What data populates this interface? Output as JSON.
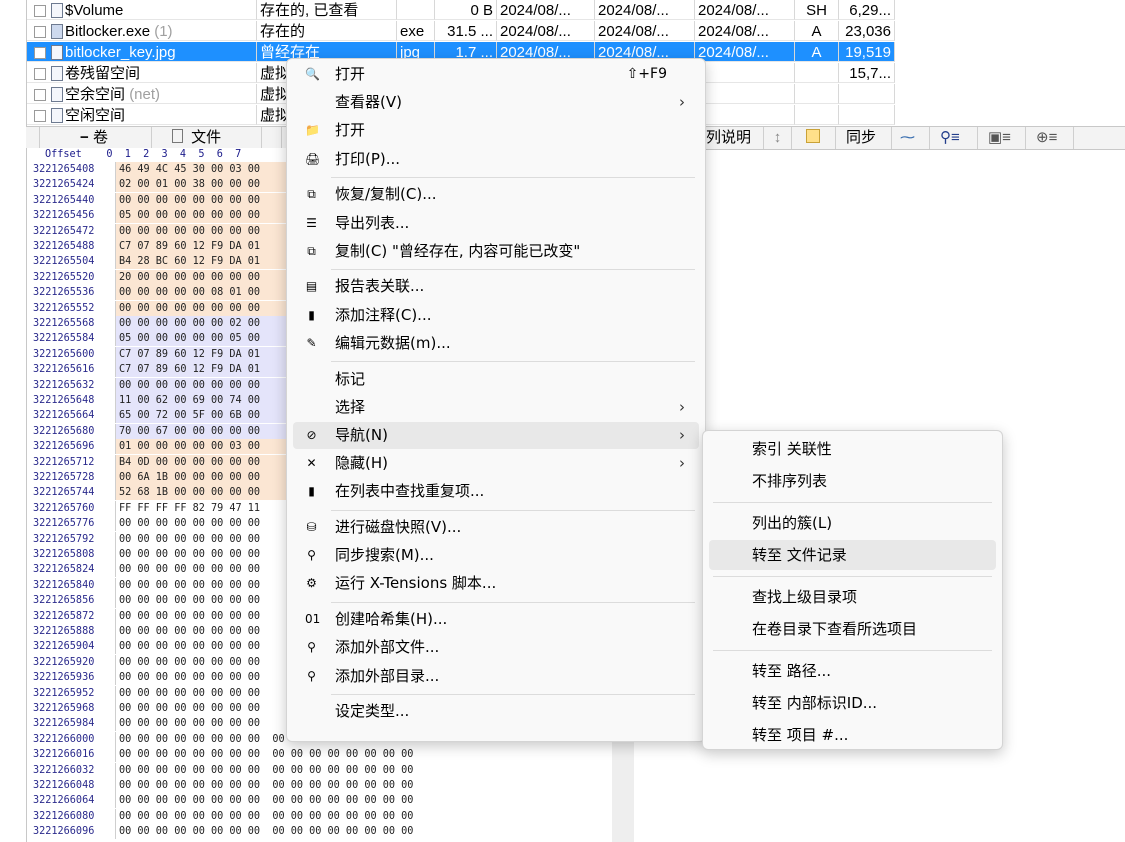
{
  "file_list": {
    "rows": [
      {
        "name": "$Volume",
        "extra": "",
        "status": "存在的, 已查看",
        "ext": "",
        "size": "0 B",
        "created": "2024/08/...",
        "modified": "2024/08/...",
        "accessed": "2024/08/...",
        "attr": "SH",
        "first_sector": "6,29...",
        "selected": false,
        "icon": "file-icon"
      },
      {
        "name": "Bitlocker.exe",
        "extra": "(1)",
        "status": "存在的",
        "ext": "exe",
        "size": "31.5 ...",
        "created": "2024/08/...",
        "modified": "2024/08/...",
        "accessed": "2024/08/...",
        "attr": "A",
        "first_sector": "23,036",
        "selected": false,
        "icon": "exe-icon"
      },
      {
        "name": "bitlocker_key.jpg",
        "extra": "",
        "status": "曾经存在",
        "ext": "jpg",
        "size": "1.7 ...",
        "created": "2024/08/...",
        "modified": "2024/08/...",
        "accessed": "2024/08/...",
        "attr": "A",
        "first_sector": "19,519",
        "selected": true,
        "icon": "file-icon"
      },
      {
        "name": "卷残留空间",
        "extra": "",
        "status": "虚拟",
        "ext": "",
        "size": "",
        "created": "",
        "modified": "",
        "accessed": "",
        "attr": "",
        "first_sector": "15,7...",
        "selected": false,
        "icon": "file-icon"
      },
      {
        "name": "空余空间",
        "extra": "(net)",
        "status": "虚拟",
        "ext": "",
        "size": "",
        "created": "",
        "modified": "",
        "accessed": "",
        "attr": "",
        "first_sector": "",
        "selected": false,
        "icon": "file-icon"
      },
      {
        "name": "空闲空间",
        "extra": "",
        "status": "虚拟",
        "ext": "",
        "size": "",
        "created": "",
        "modified": "",
        "accessed": "",
        "attr": "",
        "first_sector": "",
        "selected": false,
        "icon": "file-icon"
      }
    ]
  },
  "toolbar": {
    "volume_tab": "卷",
    "file_tab": "文件",
    "column_desc": "列说明",
    "sync": "同步"
  },
  "hex": {
    "header": "Offset    0  1  2  3  4  5  6  7",
    "rows": [
      {
        "offset": "3221265408",
        "bytes": "46 49 4C 45 30 00 03 00",
        "shade": "tan"
      },
      {
        "offset": "3221265424",
        "bytes": "02 00 01 00 38 00 00 00",
        "shade": "tan"
      },
      {
        "offset": "3221265440",
        "bytes": "00 00 00 00 00 00 00 00",
        "shade": "tan"
      },
      {
        "offset": "3221265456",
        "bytes": "05 00 00 00 00 00 00 00",
        "shade": "tan"
      },
      {
        "offset": "3221265472",
        "bytes": "00 00 00 00 00 00 00 00",
        "shade": "tan"
      },
      {
        "offset": "3221265488",
        "bytes": "C7 07 89 60 12 F9 DA 01",
        "shade": "tan"
      },
      {
        "offset": "3221265504",
        "bytes": "B4 28 BC 60 12 F9 DA 01",
        "shade": "tan"
      },
      {
        "offset": "3221265520",
        "bytes": "20 00 00 00 00 00 00 00",
        "shade": "tan"
      },
      {
        "offset": "3221265536",
        "bytes": "00 00 00 00 00 08 01 00",
        "shade": "tan"
      },
      {
        "offset": "3221265552",
        "bytes": "00 00 00 00 00 00 00 00",
        "shade": "tan"
      },
      {
        "offset": "3221265568",
        "bytes": "00 00 00 00 00 00 02 00",
        "shade": "blue"
      },
      {
        "offset": "3221265584",
        "bytes": "05 00 00 00 00 00 05 00",
        "shade": "blue"
      },
      {
        "offset": "3221265600",
        "bytes": "C7 07 89 60 12 F9 DA 01",
        "shade": "blue"
      },
      {
        "offset": "3221265616",
        "bytes": "C7 07 89 60 12 F9 DA 01",
        "shade": "blue"
      },
      {
        "offset": "3221265632",
        "bytes": "00 00 00 00 00 00 00 00",
        "shade": "blue"
      },
      {
        "offset": "3221265648",
        "bytes": "11 00 62 00 69 00 74 00",
        "shade": "blue"
      },
      {
        "offset": "3221265664",
        "bytes": "65 00 72 00 5F 00 6B 00",
        "shade": "blue"
      },
      {
        "offset": "3221265680",
        "bytes": "70 00 67 00 00 00 00 00",
        "shade": "blue"
      },
      {
        "offset": "3221265696",
        "bytes": "01 00 00 00 00 00 03 00",
        "shade": "tan"
      },
      {
        "offset": "3221265712",
        "bytes": "B4 0D 00 00 00 00 00 00",
        "shade": "tan"
      },
      {
        "offset": "3221265728",
        "bytes": "00 6A 1B 00 00 00 00 00",
        "shade": "tan"
      },
      {
        "offset": "3221265744",
        "bytes": "52 68 1B 00 00 00 00 00",
        "shade": "tan"
      },
      {
        "offset": "3221265760",
        "bytes": "FF FF FF FF 82 79 47 11",
        "shade": "none"
      },
      {
        "offset": "3221265776",
        "bytes": "00 00 00 00 00 00 00 00",
        "shade": "none"
      },
      {
        "offset": "3221265792",
        "bytes": "00 00 00 00 00 00 00 00",
        "shade": "none"
      },
      {
        "offset": "3221265808",
        "bytes": "00 00 00 00 00 00 00 00",
        "shade": "none"
      },
      {
        "offset": "3221265824",
        "bytes": "00 00 00 00 00 00 00 00",
        "shade": "none"
      },
      {
        "offset": "3221265840",
        "bytes": "00 00 00 00 00 00 00 00",
        "shade": "none"
      },
      {
        "offset": "3221265856",
        "bytes": "00 00 00 00 00 00 00 00",
        "shade": "none"
      },
      {
        "offset": "3221265872",
        "bytes": "00 00 00 00 00 00 00 00",
        "shade": "none"
      },
      {
        "offset": "3221265888",
        "bytes": "00 00 00 00 00 00 00 00",
        "shade": "none"
      },
      {
        "offset": "3221265904",
        "bytes": "00 00 00 00 00 00 00 00",
        "shade": "none"
      },
      {
        "offset": "3221265920",
        "bytes": "00 00 00 00 00 00 00 00",
        "shade": "none"
      },
      {
        "offset": "3221265936",
        "bytes": "00 00 00 00 00 00 00 00",
        "shade": "none"
      },
      {
        "offset": "3221265952",
        "bytes": "00 00 00 00 00 00 00 00",
        "shade": "none"
      },
      {
        "offset": "3221265968",
        "bytes": "00 00 00 00 00 00 00 00",
        "shade": "none"
      },
      {
        "offset": "3221265984",
        "bytes": "00 00 00 00 00 00 00 00",
        "shade": "none"
      },
      {
        "offset": "3221266000",
        "bytes": "00 00 00 00 00 00 00 00  00 00 00 00 00 00 00 00",
        "shade": "none"
      },
      {
        "offset": "3221266016",
        "bytes": "00 00 00 00 00 00 00 00  00 00 00 00 00 00 00 00",
        "shade": "none"
      },
      {
        "offset": "3221266032",
        "bytes": "00 00 00 00 00 00 00 00  00 00 00 00 00 00 00 00",
        "shade": "none"
      },
      {
        "offset": "3221266048",
        "bytes": "00 00 00 00 00 00 00 00  00 00 00 00 00 00 00 00",
        "shade": "none"
      },
      {
        "offset": "3221266064",
        "bytes": "00 00 00 00 00 00 00 00  00 00 00 00 00 00 00 00",
        "shade": "none"
      },
      {
        "offset": "3221266080",
        "bytes": "00 00 00 00 00 00 00 00  00 00 00 00 00 00 00 00",
        "shade": "none"
      },
      {
        "offset": "3221266096",
        "bytes": "00 00 00 00 00 00 00 00  00 00 00 00 00 00 00 00",
        "shade": "none"
      }
    ]
  },
  "context_menu": {
    "items": [
      {
        "label": "打开",
        "shortcut": "⇧+F9",
        "icon": "view-icon",
        "glyph": "🔍",
        "arrow": false,
        "sep_after": false
      },
      {
        "label": "查看器(V)",
        "shortcut": "",
        "icon": "",
        "glyph": "",
        "arrow": true,
        "sep_after": false
      },
      {
        "label": "打开",
        "shortcut": "",
        "icon": "folder-icon",
        "glyph": "📁",
        "arrow": false,
        "sep_after": false
      },
      {
        "label": "打印(P)...",
        "shortcut": "",
        "icon": "printer-icon",
        "glyph": "🖨",
        "arrow": false,
        "sep_after": true
      },
      {
        "label": "恢复/复制(C)...",
        "shortcut": "",
        "icon": "copy-icon",
        "glyph": "⧉",
        "arrow": false,
        "sep_after": false
      },
      {
        "label": "导出列表...",
        "shortcut": "",
        "icon": "list-icon",
        "glyph": "☰",
        "arrow": false,
        "sep_after": false
      },
      {
        "label": "复制(C) \"曾经存在, 内容可能已改变\"",
        "shortcut": "",
        "icon": "clipboard-icon",
        "glyph": "⧉",
        "arrow": false,
        "sep_after": true
      },
      {
        "label": "报告表关联...",
        "shortcut": "",
        "icon": "report-icon",
        "glyph": "▤",
        "arrow": false,
        "sep_after": false
      },
      {
        "label": "添加注释(C)...",
        "shortcut": "",
        "icon": "note-icon",
        "glyph": "▮",
        "arrow": false,
        "sep_after": false
      },
      {
        "label": "编辑元数据(m)...",
        "shortcut": "",
        "icon": "pencil-icon",
        "glyph": "✎",
        "arrow": false,
        "sep_after": true
      },
      {
        "label": "标记",
        "shortcut": "",
        "icon": "",
        "glyph": "",
        "arrow": false,
        "sep_after": false
      },
      {
        "label": "选择",
        "shortcut": "",
        "icon": "",
        "glyph": "",
        "arrow": true,
        "sep_after": false
      },
      {
        "label": "导航(N)",
        "shortcut": "",
        "icon": "compass-icon",
        "glyph": "⊘",
        "arrow": true,
        "sep_after": false,
        "highlighted": true
      },
      {
        "label": "隐藏(H)",
        "shortcut": "",
        "icon": "close-icon",
        "glyph": "✕",
        "arrow": true,
        "sep_after": false
      },
      {
        "label": "在列表中查找重复项...",
        "shortcut": "",
        "icon": "duplicate-icon",
        "glyph": "▮",
        "arrow": false,
        "sep_after": true
      },
      {
        "label": "进行磁盘快照(V)...",
        "shortcut": "",
        "icon": "snapshot-icon",
        "glyph": "⛁",
        "arrow": false,
        "sep_after": false
      },
      {
        "label": "同步搜索(M)...",
        "shortcut": "",
        "icon": "binoculars-icon",
        "glyph": "⚲",
        "arrow": false,
        "sep_after": false
      },
      {
        "label": "运行 X-Tensions 脚本...",
        "shortcut": "",
        "icon": "gear-icon",
        "glyph": "⚙",
        "arrow": false,
        "sep_after": true
      },
      {
        "label": "创建哈希集(H)...",
        "shortcut": "",
        "icon": "hash-icon",
        "glyph": "01",
        "arrow": false,
        "sep_after": false
      },
      {
        "label": "添加外部文件...",
        "shortcut": "",
        "icon": "paperclip-icon",
        "glyph": "⚲",
        "arrow": false,
        "sep_after": false
      },
      {
        "label": "添加外部目录...",
        "shortcut": "",
        "icon": "paperclip-icon",
        "glyph": "⚲",
        "arrow": false,
        "sep_after": true
      },
      {
        "label": "设定类型...",
        "shortcut": "",
        "icon": "",
        "glyph": "",
        "arrow": false,
        "sep_after": false
      }
    ]
  },
  "submenu": {
    "items": [
      {
        "label": "索引 关联性",
        "sep_after": false
      },
      {
        "label": "不排序列表",
        "sep_after": true
      },
      {
        "label": "列出的簇(L)",
        "sep_after": false
      },
      {
        "label": "转至 文件记录",
        "sep_after": true,
        "highlighted": true
      },
      {
        "label": "查找上级目录项",
        "sep_after": false
      },
      {
        "label": "在卷目录下查看所选项目",
        "sep_after": true
      },
      {
        "label": "转至 路径...",
        "sep_after": false
      },
      {
        "label": "转至 内部标识ID...",
        "sep_after": false
      },
      {
        "label": "转至 项目 #...",
        "sep_after": false
      }
    ]
  },
  "colors": {
    "selection": "#1e90ff",
    "menu_bg": "#f9f9f9",
    "menu_highlight": "#e8e8e8",
    "hex_tan": "#fbe6d3",
    "hex_blue": "#e4e4fa"
  }
}
